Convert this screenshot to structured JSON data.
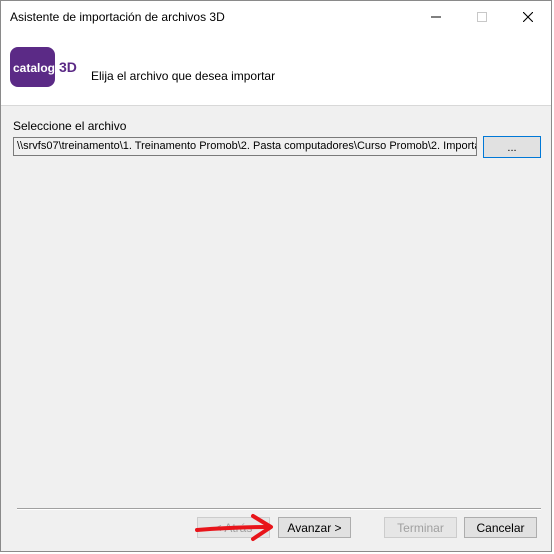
{
  "window": {
    "title": "Asistente de importación de archivos 3D"
  },
  "header": {
    "logo_word": "catalog",
    "logo_3d": "3D",
    "instruction": "Elija el archivo que desea importar"
  },
  "file_select": {
    "label": "Seleccione el archivo",
    "path_value": "\\\\srvfs07\\treinamento\\1. Treinamento Promob\\2. Pasta computadores\\Curso Promob\\2. Importa",
    "browse_label": "..."
  },
  "footer": {
    "back_label": "< Atrás",
    "next_label": "Avanzar >",
    "finish_label": "Terminar",
    "cancel_label": "Cancelar"
  },
  "colors": {
    "logo_purple": "#5b2a86",
    "focus_blue": "#0078d7",
    "annotation_red": "#e8141a"
  }
}
